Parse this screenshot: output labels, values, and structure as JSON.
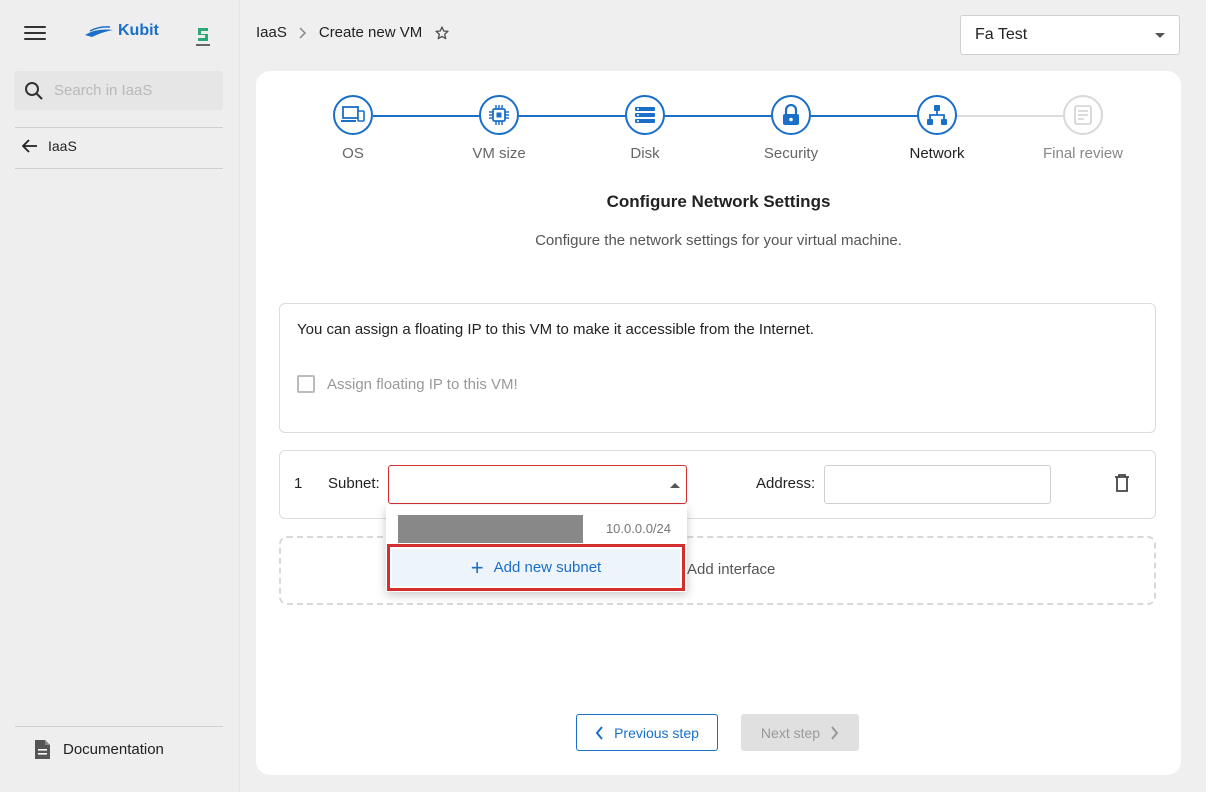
{
  "sidebar": {
    "brand": "Kubit",
    "search_placeholder": "Search in IaaS",
    "back_label": "IaaS",
    "documentation_label": "Documentation"
  },
  "header": {
    "breadcrumb_root": "IaaS",
    "breadcrumb_current": "Create new VM",
    "tenant": "Fa Test"
  },
  "stepper": {
    "steps": [
      {
        "label": "OS",
        "state": "done",
        "icon": "devices-icon"
      },
      {
        "label": "VM size",
        "state": "done",
        "icon": "chip-icon"
      },
      {
        "label": "Disk",
        "state": "done",
        "icon": "storage-icon"
      },
      {
        "label": "Security",
        "state": "done",
        "icon": "lock-icon"
      },
      {
        "label": "Network",
        "state": "active",
        "icon": "network-icon"
      },
      {
        "label": "Final review",
        "state": "todo",
        "icon": "review-icon"
      }
    ]
  },
  "main": {
    "title": "Configure Network Settings",
    "subtitle": "Configure the network settings for your virtual machine.",
    "floating_ip_text": "You can assign a floating IP to this VM to make it accessible from the Internet.",
    "floating_ip_checkbox_label": "Assign floating IP to this VM!",
    "interface": {
      "index": "1",
      "subnet_label": "Subnet:",
      "subnet_value": "",
      "address_label": "Address:",
      "address_value": ""
    },
    "add_interface_label": "Add interface"
  },
  "dropdown": {
    "options": [
      {
        "cidr": "10.0.0.0/24"
      }
    ],
    "add_new_subnet_label": "Add new subnet"
  },
  "footer": {
    "previous_label": "Previous step",
    "next_label": "Next step"
  },
  "colors": {
    "accent": "#1a6fc9",
    "error": "#d32f2f"
  }
}
